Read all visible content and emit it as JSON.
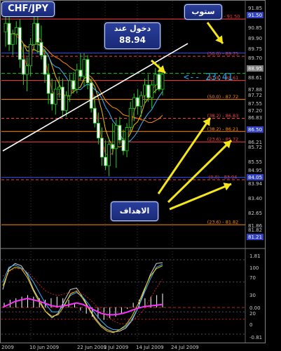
{
  "chart_data": {
    "type": "candlestick",
    "symbol": "CHF/JPY",
    "callouts": {
      "stop": "ستوب",
      "entry_label": "دخول عند",
      "entry_price": "88.94",
      "targets": "الاهداف"
    },
    "countdown": "<-- 23:41",
    "price_axis_ticks": [
      "91.85",
      "91.50",
      "91.50",
      "90.85",
      "89.90",
      "89.75",
      "89.70",
      "88.95",
      "88.61",
      "87.88",
      "87.72",
      "87.55",
      "87.20",
      "86.83",
      "86.50",
      "86.21",
      "85.72",
      "85.55",
      "84.95",
      "84.05",
      "83.94",
      "83.40",
      "82.65",
      "81.86",
      "81.82",
      "81.21"
    ],
    "price_ylim": [
      80.9,
      92.2
    ],
    "fib_levels": [
      {
        "label": "(100.0) - 91.50",
        "value": 91.5,
        "color": "#ff4040"
      },
      {
        "label": "(50.0) - 89.75",
        "value": 89.75,
        "color": "#ff4040"
      },
      {
        "label": "(61.8) - 88.61",
        "value": 88.61,
        "color": "#ff4040"
      },
      {
        "label": "(50.0) - 87.72",
        "value": 87.72,
        "color": "#ff8c00"
      },
      {
        "label": "(38.2) - 86.83",
        "value": 86.83,
        "color": "#ff4040"
      },
      {
        "label": "(38.2) - 86.21",
        "value": 86.21,
        "color": "#ff8c00"
      },
      {
        "label": "(23.6) - 85.72",
        "value": 85.72,
        "color": "#ff4040"
      },
      {
        "label": "(0.0) - 83.94",
        "value": 83.94,
        "color": "#ff4040"
      },
      {
        "label": "(23.6) - 81.82",
        "value": 81.82,
        "color": "#ff8c00"
      }
    ],
    "x_ticks": [
      "2009",
      "10 Jun 2009",
      "22 Jun 2009",
      "2 Jul 2009",
      "14 Jul 2009",
      "24 Jul 2009"
    ],
    "candles": [
      {
        "o": 90.9,
        "h": 91.7,
        "l": 90.2,
        "c": 91.3
      },
      {
        "o": 91.3,
        "h": 91.6,
        "l": 90.0,
        "c": 90.3
      },
      {
        "o": 90.3,
        "h": 91.0,
        "l": 89.8,
        "c": 90.8
      },
      {
        "o": 90.8,
        "h": 91.4,
        "l": 90.3,
        "c": 91.1
      },
      {
        "o": 91.1,
        "h": 91.5,
        "l": 89.2,
        "c": 89.6
      },
      {
        "o": 89.6,
        "h": 90.3,
        "l": 88.4,
        "c": 88.9
      },
      {
        "o": 88.9,
        "h": 89.7,
        "l": 88.1,
        "c": 89.3
      },
      {
        "o": 89.3,
        "h": 90.6,
        "l": 88.8,
        "c": 90.3
      },
      {
        "o": 90.3,
        "h": 91.7,
        "l": 90.0,
        "c": 91.3
      },
      {
        "o": 91.3,
        "h": 91.6,
        "l": 89.9,
        "c": 90.4
      },
      {
        "o": 90.4,
        "h": 91.2,
        "l": 89.6,
        "c": 89.8
      },
      {
        "o": 89.8,
        "h": 90.1,
        "l": 88.5,
        "c": 88.9
      },
      {
        "o": 88.9,
        "h": 89.4,
        "l": 87.5,
        "c": 88.0
      },
      {
        "o": 88.0,
        "h": 88.7,
        "l": 87.2,
        "c": 87.5
      },
      {
        "o": 87.5,
        "h": 88.6,
        "l": 87.0,
        "c": 88.2
      },
      {
        "o": 88.2,
        "h": 88.8,
        "l": 87.8,
        "c": 88.3
      },
      {
        "o": 88.3,
        "h": 88.7,
        "l": 86.9,
        "c": 87.2
      },
      {
        "o": 87.2,
        "h": 88.1,
        "l": 86.9,
        "c": 87.9
      },
      {
        "o": 87.9,
        "h": 88.9,
        "l": 87.6,
        "c": 88.6
      },
      {
        "o": 88.6,
        "h": 89.0,
        "l": 88.0,
        "c": 88.2
      },
      {
        "o": 88.2,
        "h": 89.4,
        "l": 88.0,
        "c": 89.1
      },
      {
        "o": 89.1,
        "h": 89.9,
        "l": 88.6,
        "c": 88.8
      },
      {
        "o": 88.8,
        "h": 89.9,
        "l": 88.3,
        "c": 89.6
      },
      {
        "o": 89.6,
        "h": 89.8,
        "l": 88.2,
        "c": 88.5
      },
      {
        "o": 88.5,
        "h": 88.7,
        "l": 87.1,
        "c": 87.3
      },
      {
        "o": 87.3,
        "h": 87.9,
        "l": 86.4,
        "c": 86.6
      },
      {
        "o": 86.6,
        "h": 87.1,
        "l": 85.6,
        "c": 85.9
      },
      {
        "o": 85.9,
        "h": 86.4,
        "l": 84.6,
        "c": 85.0
      },
      {
        "o": 85.0,
        "h": 85.8,
        "l": 84.4,
        "c": 84.6
      },
      {
        "o": 84.6,
        "h": 85.9,
        "l": 84.1,
        "c": 85.6
      },
      {
        "o": 85.6,
        "h": 86.6,
        "l": 85.1,
        "c": 85.4
      },
      {
        "o": 85.4,
        "h": 86.8,
        "l": 84.5,
        "c": 86.5
      },
      {
        "o": 86.5,
        "h": 86.9,
        "l": 85.6,
        "c": 85.8
      },
      {
        "o": 85.8,
        "h": 86.3,
        "l": 85.1,
        "c": 85.3
      },
      {
        "o": 85.3,
        "h": 86.6,
        "l": 85.0,
        "c": 86.4
      },
      {
        "o": 86.4,
        "h": 87.6,
        "l": 86.2,
        "c": 87.3
      },
      {
        "o": 87.3,
        "h": 88.0,
        "l": 86.7,
        "c": 87.8
      },
      {
        "o": 87.8,
        "h": 88.2,
        "l": 87.0,
        "c": 87.4
      },
      {
        "o": 87.4,
        "h": 88.1,
        "l": 86.9,
        "c": 87.9
      },
      {
        "o": 87.9,
        "h": 88.7,
        "l": 87.5,
        "c": 88.4
      },
      {
        "o": 88.4,
        "h": 88.9,
        "l": 87.6,
        "c": 87.8
      },
      {
        "o": 87.8,
        "h": 88.6,
        "l": 87.3,
        "c": 88.4
      },
      {
        "o": 88.4,
        "h": 89.2,
        "l": 88.0,
        "c": 88.9
      },
      {
        "o": 88.9,
        "h": 89.4,
        "l": 88.1,
        "c": 88.2
      },
      {
        "o": 88.2,
        "h": 89.1,
        "l": 87.9,
        "c": 88.9
      }
    ],
    "osc_ticks": [
      "1.81",
      "100",
      "70",
      "30",
      "0.00",
      "20",
      "0",
      "-0.81"
    ],
    "osc_ylim": [
      0,
      100
    ],
    "osc_series": [
      {
        "color": "#d8d8d8",
        "values": [
          60,
          88,
          95,
          92,
          80,
          60,
          45,
          30,
          22,
          28,
          45,
          60,
          62,
          50,
          35,
          22,
          12,
          6,
          3,
          4,
          8,
          18,
          35,
          58,
          80,
          95,
          96
        ]
      },
      {
        "color": "#3cb0ff",
        "values": [
          70,
          90,
          93,
          89,
          82,
          70,
          55,
          40,
          30,
          30,
          40,
          52,
          56,
          50,
          40,
          28,
          18,
          10,
          6,
          6,
          10,
          20,
          35,
          55,
          74,
          90,
          94
        ]
      },
      {
        "color": "#f0d000",
        "values": [
          65,
          85,
          90,
          88,
          76,
          58,
          42,
          30,
          24,
          26,
          38,
          54,
          58,
          48,
          34,
          20,
          10,
          4,
          2,
          6,
          12,
          24,
          40,
          60,
          78,
          88,
          92
        ]
      },
      {
        "color": "#ff30ff",
        "values": [
          36,
          40,
          44,
          46,
          48,
          46,
          44,
          41,
          38,
          37,
          38,
          40,
          42,
          40,
          36,
          32,
          28,
          26,
          26,
          27,
          29,
          32,
          35,
          37,
          38,
          39,
          40
        ]
      },
      {
        "color": "#c02020",
        "values": [
          78,
          84,
          88,
          88,
          84,
          76,
          66,
          58,
          54,
          52,
          54,
          56,
          57,
          54,
          48,
          40,
          32,
          24,
          18,
          14,
          14,
          18,
          24,
          34,
          48,
          62,
          74
        ]
      }
    ],
    "osc_histogram": [
      3,
      5,
      6,
      7,
      8,
      7,
      6,
      5,
      6,
      7,
      6,
      5,
      3,
      -2,
      -4,
      -6,
      -7,
      -8,
      -7,
      -6,
      -4,
      -1,
      3,
      5,
      6,
      7,
      8,
      9
    ]
  }
}
